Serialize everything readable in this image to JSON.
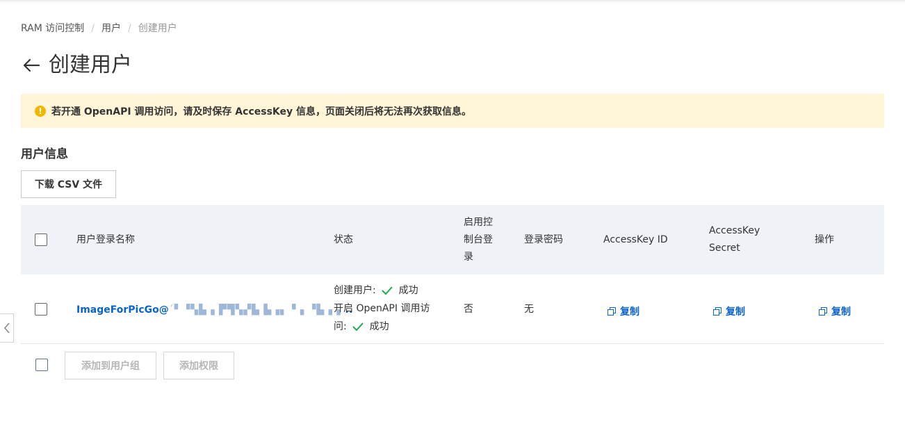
{
  "breadcrumb": {
    "items": [
      "RAM 访问控制",
      "用户",
      "创建用户"
    ]
  },
  "page": {
    "title": "创建用户"
  },
  "alert": {
    "icon": "warning-icon",
    "text": "若开通 OpenAPI 调用访问，请及时保存 AccessKey 信息，页面关闭后将无法再次获取信息。",
    "color": "#fff6d8"
  },
  "section": {
    "title": "用户信息",
    "download_label": "下载 CSV 文件"
  },
  "table": {
    "headers": {
      "login_name": "用户登录名称",
      "status": "状态",
      "console_login": "启用控制台登录",
      "console_login_lines": [
        "启用控",
        "制台登",
        "录"
      ],
      "password": "登录密码",
      "access_key_id": "AccessKey ID",
      "access_key_secret_lines": [
        "AccessKey",
        "Secret"
      ],
      "operation": "操作"
    },
    "rows": [
      {
        "login_name": "ImageForPicGo@",
        "login_name_redacted": "´▘▝▚▙▗ ▛▜▚▞▙ ▙▗▖▝▗ ▝▙▗▗",
        "login_name_ellipsis": "..",
        "status_create_label": "创建用户:",
        "status_create_value": "成功",
        "status_openapi_label_line1": "开启 OpenAPI 调用访",
        "status_openapi_label_line2": "问:",
        "status_openapi_value": "成功",
        "console_login": "否",
        "password": "无",
        "access_key_id_action": "复制",
        "access_key_secret_action": "复制",
        "operation_action": "复制"
      }
    ]
  },
  "footer": {
    "add_to_group_label": "添加到用户组",
    "add_permission_label": "添加权限"
  },
  "colors": {
    "link": "#0a63c8",
    "success": "#1ea94b",
    "header_bg": "#eff2f6"
  }
}
